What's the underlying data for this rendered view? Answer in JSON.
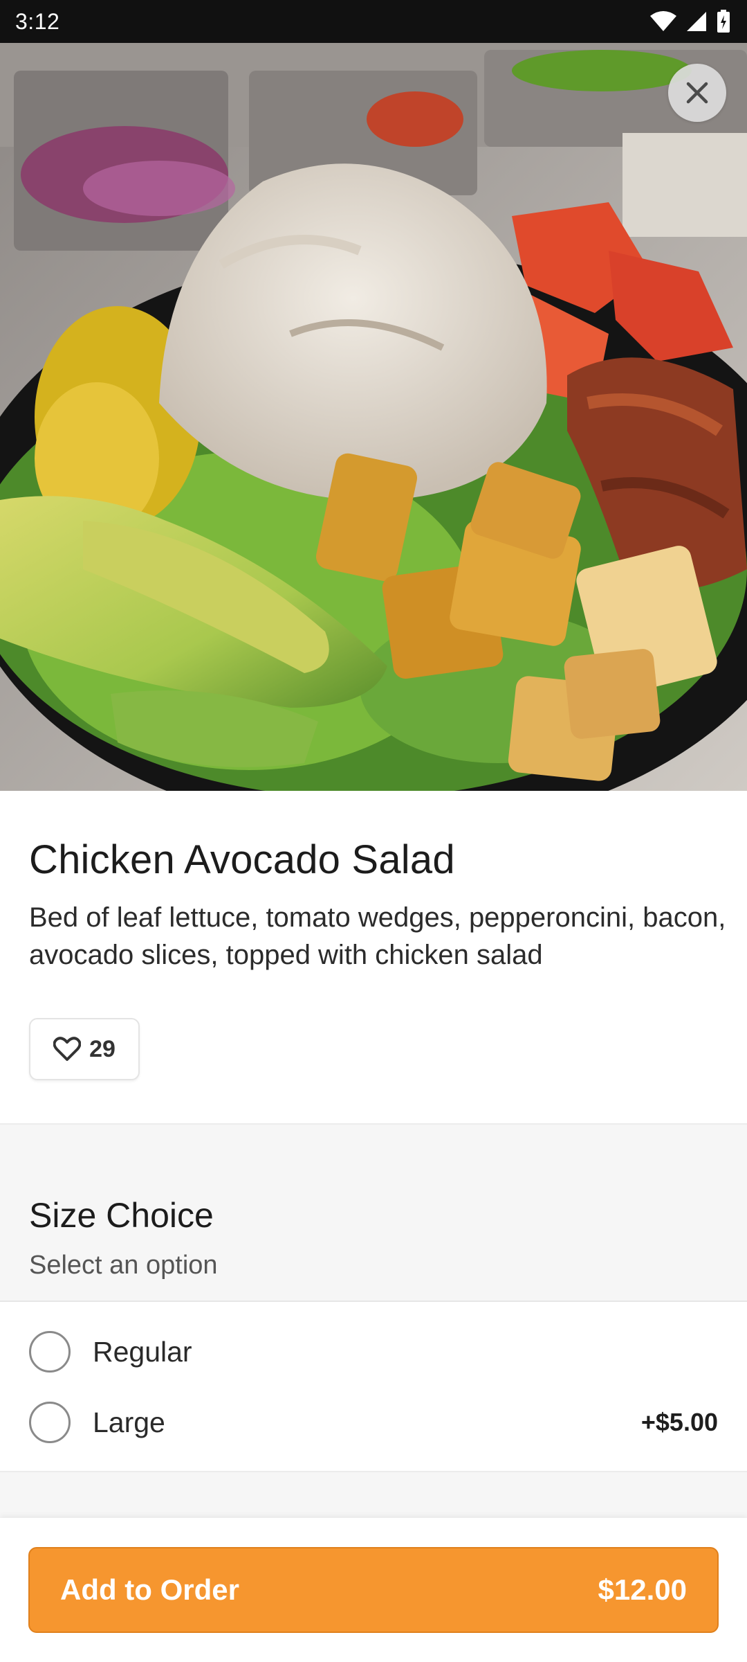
{
  "status_bar": {
    "time": "3:12",
    "icons": [
      "wifi-icon",
      "cellular-signal-icon",
      "battery-icon"
    ]
  },
  "hero": {
    "image": "chicken-avocado-salad-photo",
    "close_icon": "close-icon"
  },
  "item": {
    "title": "Chicken Avocado Salad",
    "description": "Bed of leaf lettuce, tomato wedges, pepperoncini, bacon, avocado slices, topped with chicken salad",
    "like_count": "29",
    "like_icon": "heart-icon"
  },
  "size_choice": {
    "title": "Size Choice",
    "subtitle": "Select an option",
    "options": [
      {
        "label": "Regular",
        "price": "",
        "selected": false
      },
      {
        "label": "Large",
        "price": "+$5.00",
        "selected": false
      }
    ]
  },
  "footer": {
    "add_label": "Add to Order",
    "price": "$12.00"
  },
  "colors": {
    "accent": "#f6962f",
    "status_bar": "#111111",
    "section_bg": "#f6f6f6"
  }
}
